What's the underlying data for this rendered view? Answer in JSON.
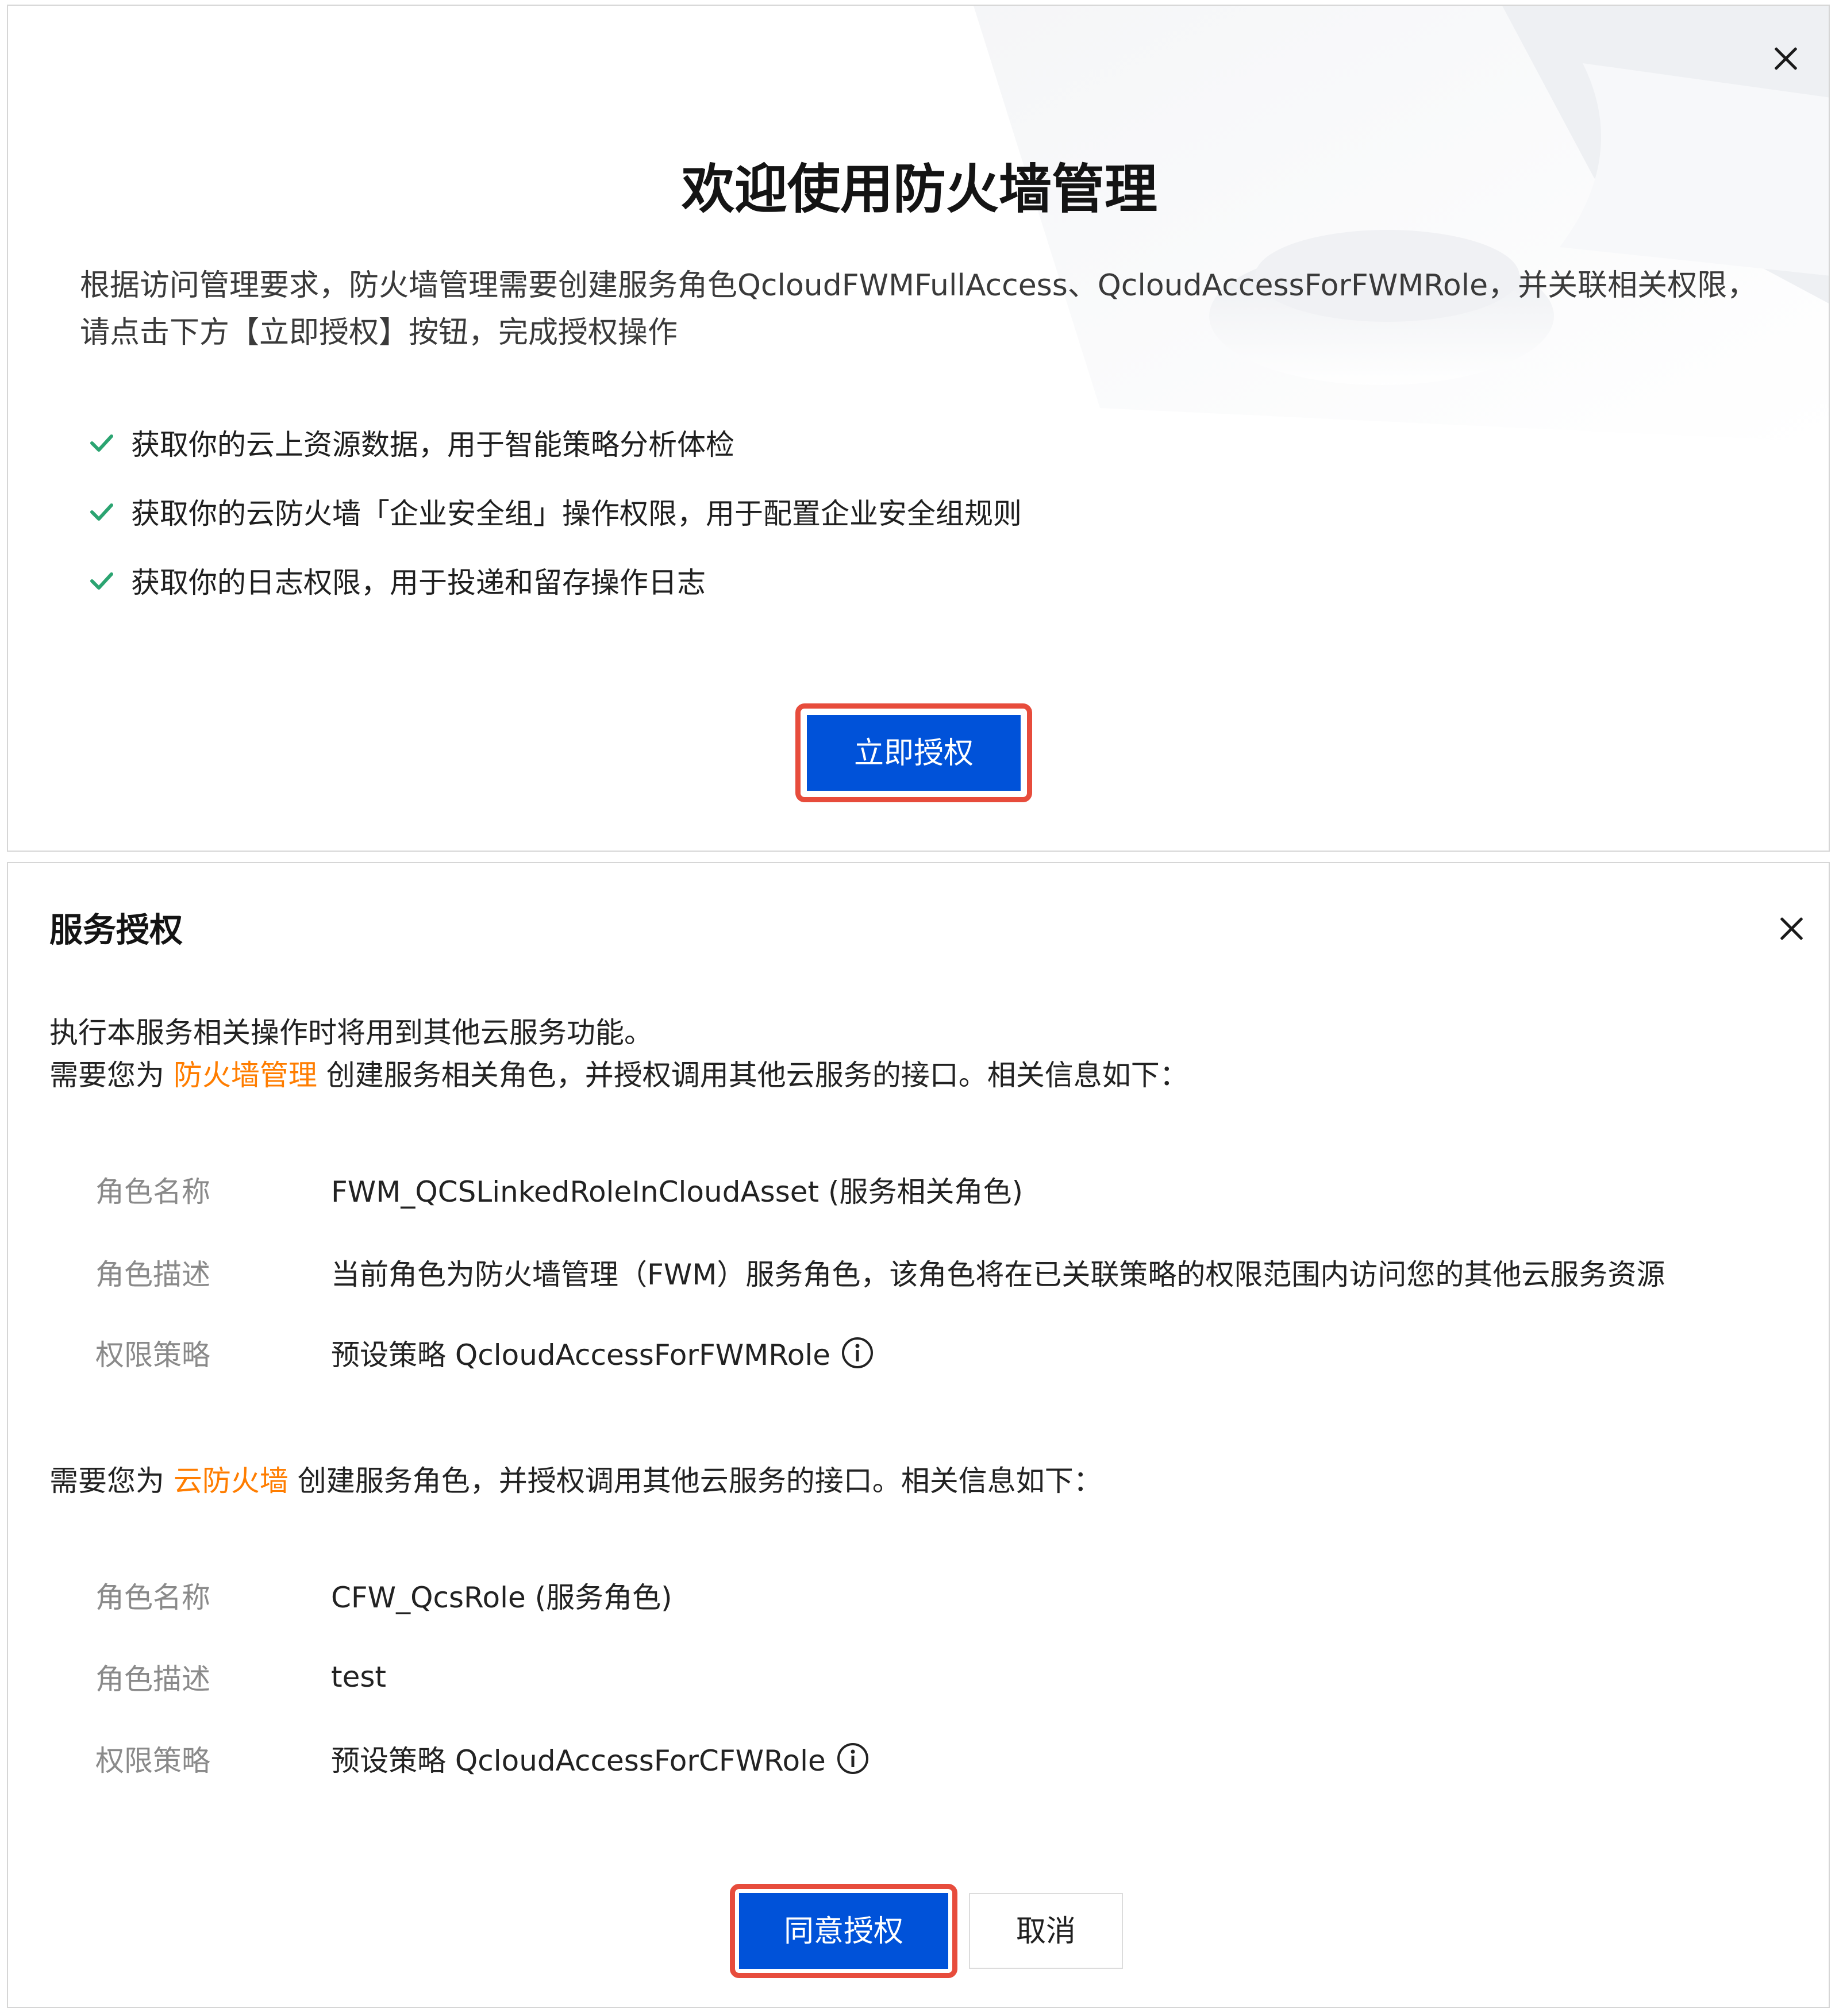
{
  "welcome_dialog": {
    "title": "欢迎使用防火墙管理",
    "intro": "根据访问管理要求，防火墙管理需要创建服务角色QcloudFWMFullAccess、QcloudAccessForFWMRole，并关联相关权限，请点击下方【立即授权】按钮，完成授权操作",
    "checklist": [
      "获取你的云上资源数据，用于智能策略分析体检",
      "获取你的云防火墙「企业安全组」操作权限，用于配置企业安全组规则",
      "获取你的日志权限，用于投递和留存操作日志"
    ],
    "authorize_button": "立即授权"
  },
  "service_auth_dialog": {
    "title": "服务授权",
    "intro_line1": "执行本服务相关操作时将用到其他云服务功能。",
    "section1": {
      "prefix": "需要您为 ",
      "service": "防火墙管理",
      "suffix": " 创建服务相关角色，并授权调用其他云服务的接口。相关信息如下：",
      "rows": [
        {
          "label": "角色名称",
          "value": "FWM_QCSLinkedRoleInCloudAsset (服务相关角色)"
        },
        {
          "label": "角色描述",
          "value": "当前角色为防火墙管理（FWM）服务角色，该角色将在已关联策略的权限范围内访问您的其他云服务资源"
        },
        {
          "label": "权限策略",
          "value": "预设策略 QcloudAccessForFWMRole"
        }
      ]
    },
    "section2": {
      "prefix": "需要您为 ",
      "service": "云防火墙",
      "suffix": " 创建服务角色，并授权调用其他云服务的接口。相关信息如下：",
      "rows": [
        {
          "label": "角色名称",
          "value": "CFW_QcsRole (服务角色)"
        },
        {
          "label": "角色描述",
          "value": "test"
        },
        {
          "label": "权限策略",
          "value": "预设策略 QcloudAccessForCFWRole"
        }
      ]
    },
    "agree_button": "同意授权",
    "cancel_button": "取消"
  },
  "colors": {
    "primary": "#0052d9",
    "accent": "#ff7d00",
    "highlight_border": "#e74c3c",
    "check": "#2ba471"
  },
  "icons": [
    "close-icon",
    "check-icon",
    "info-icon"
  ]
}
